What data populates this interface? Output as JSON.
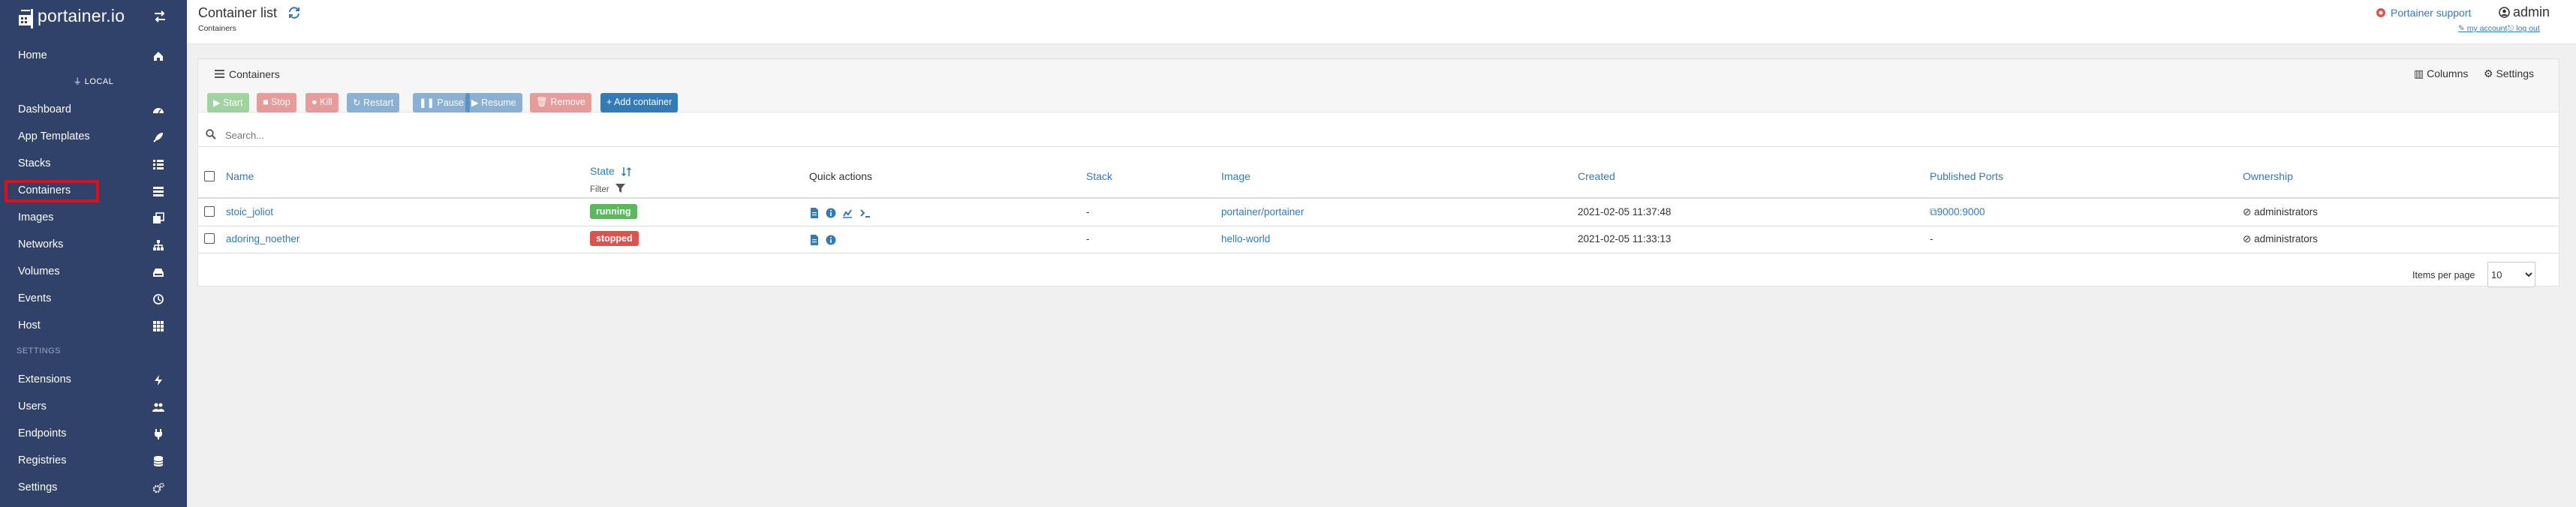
{
  "brand": {
    "logo_text": "portainer.io"
  },
  "sidebar": {
    "top_items": [
      {
        "label": "Home",
        "icon": "home-icon"
      }
    ],
    "endpoint_label": "LOCAL",
    "endpoint_items": [
      {
        "label": "Dashboard",
        "icon": "tachometer-icon"
      },
      {
        "label": "App Templates",
        "icon": "rocket-icon"
      },
      {
        "label": "Stacks",
        "icon": "list-icon"
      },
      {
        "label": "Containers",
        "icon": "server-icon",
        "active": true
      },
      {
        "label": "Images",
        "icon": "clone-icon"
      },
      {
        "label": "Networks",
        "icon": "sitemap-icon"
      },
      {
        "label": "Volumes",
        "icon": "hdd-icon"
      },
      {
        "label": "Events",
        "icon": "history-icon"
      },
      {
        "label": "Host",
        "icon": "th-icon"
      }
    ],
    "settings_section": "SETTINGS",
    "settings_items": [
      {
        "label": "Extensions",
        "icon": "bolt-icon"
      },
      {
        "label": "Users",
        "icon": "users-icon"
      },
      {
        "label": "Endpoints",
        "icon": "plug-icon"
      },
      {
        "label": "Registries",
        "icon": "database-icon"
      },
      {
        "label": "Settings",
        "icon": "cogs-icon"
      }
    ]
  },
  "header": {
    "title": "Container list",
    "breadcrumb": "Containers",
    "support_link": "Portainer support",
    "user": "admin",
    "my_account": "my account",
    "logout": "log out"
  },
  "widget": {
    "title": "Containers",
    "columns_label": "Columns",
    "settings_label": "Settings",
    "actions": {
      "start": "Start",
      "stop": "Stop",
      "kill": "Kill",
      "restart": "Restart",
      "pause": "Pause",
      "resume": "Resume",
      "remove": "Remove",
      "add": "Add container"
    },
    "search_placeholder": "Search...",
    "columns": {
      "name": "Name",
      "state": "State",
      "filter": "Filter",
      "quick_actions": "Quick actions",
      "stack": "Stack",
      "image": "Image",
      "created": "Created",
      "ports": "Published Ports",
      "ownership": "Ownership"
    },
    "rows": [
      {
        "name": "stoic_joliot",
        "state": "running",
        "stack": "-",
        "image": "portainer/portainer",
        "created": "2021-02-05 11:37:48",
        "ports": "9000:9000",
        "ownership": "administrators"
      },
      {
        "name": "adoring_noether",
        "state": "stopped",
        "stack": "-",
        "image": "hello-world",
        "created": "2021-02-05 11:33:13",
        "ports": "-",
        "ownership": "administrators"
      }
    ],
    "items_per_page_label": "Items per page",
    "items_per_page": "10"
  },
  "colors": {
    "sidebar_bg": "#30426a",
    "link": "#337ab7",
    "success": "#5cb85c",
    "danger": "#d9534f",
    "highlight": "#e10d19"
  }
}
